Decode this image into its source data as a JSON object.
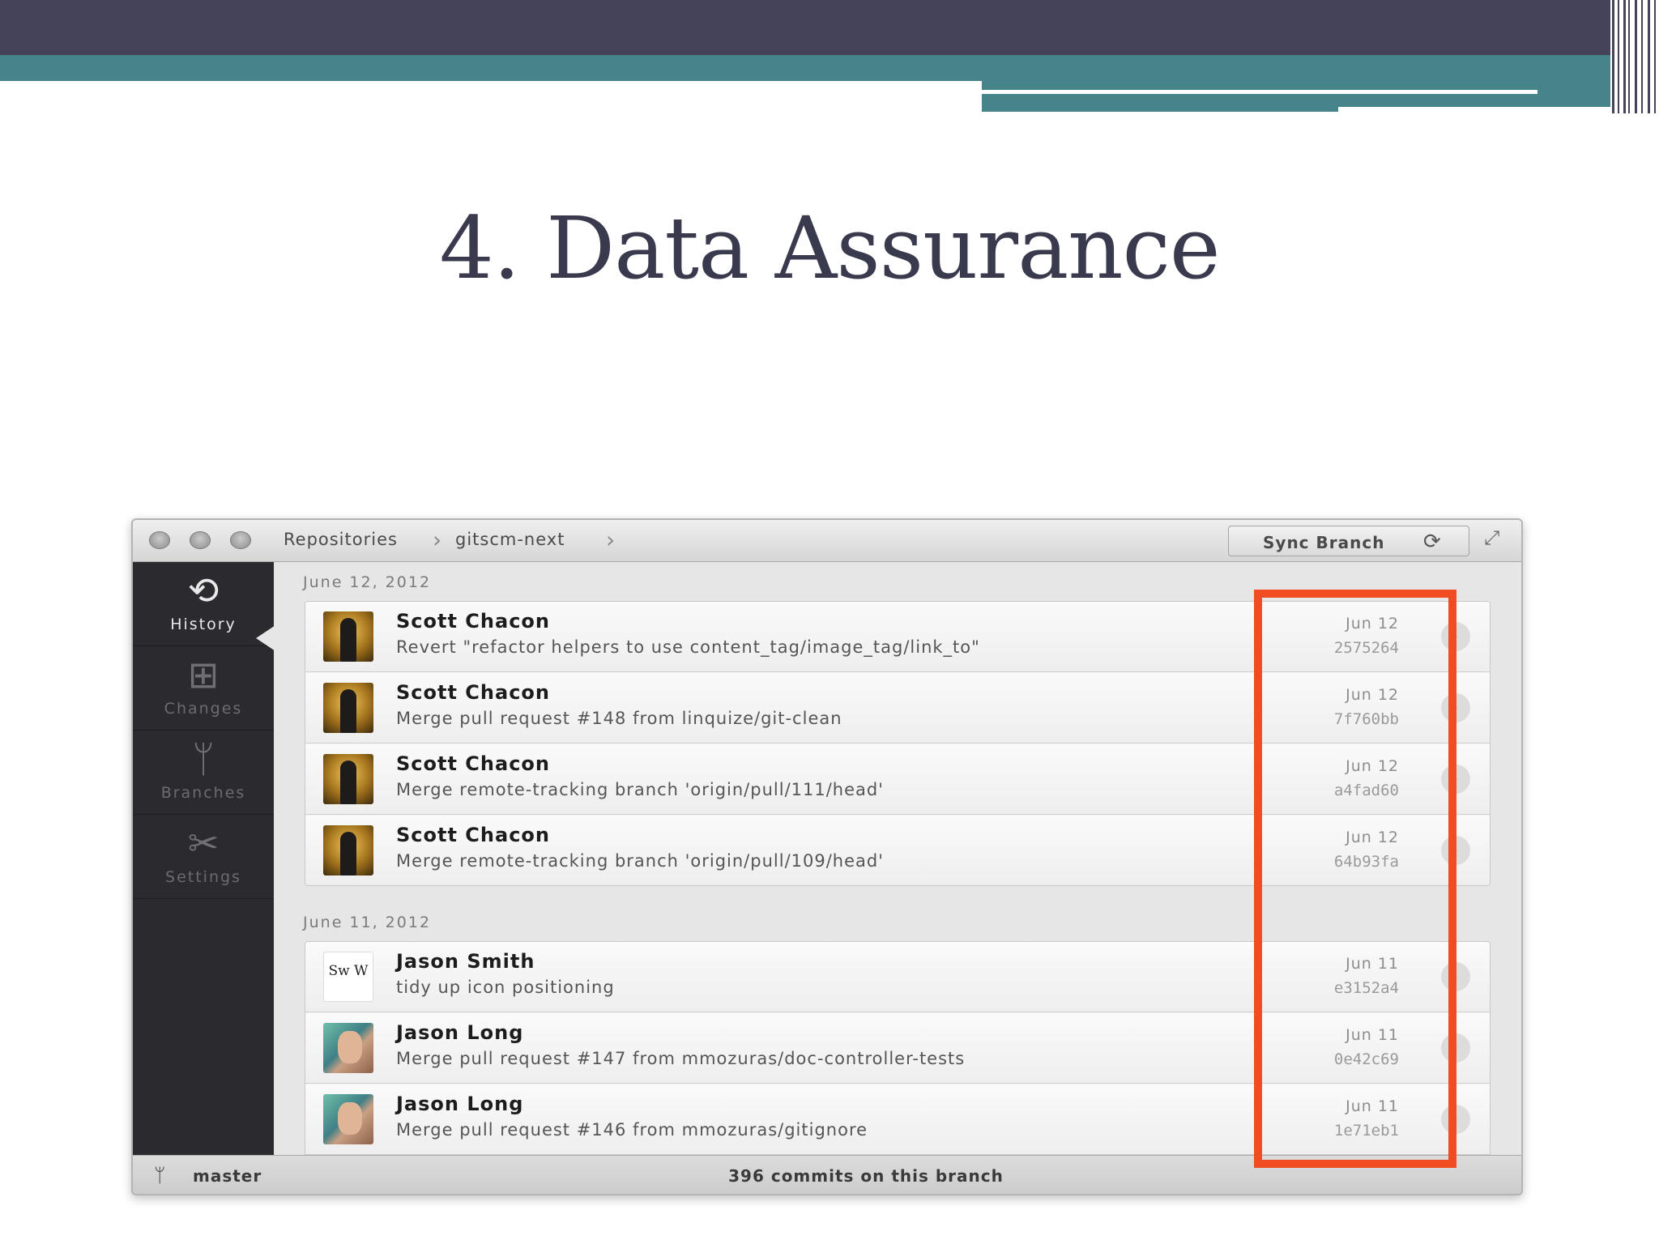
{
  "slide": {
    "title": "4. Data Assurance"
  },
  "window": {
    "breadcrumb": [
      "Repositories",
      "gitscm-next"
    ],
    "sync_button_label": "Sync Branch",
    "sidebar": [
      {
        "label": "History",
        "icon": "history-icon",
        "active": true
      },
      {
        "label": "Changes",
        "icon": "changes-icon",
        "active": false
      },
      {
        "label": "Branches",
        "icon": "branches-icon",
        "active": false
      },
      {
        "label": "Settings",
        "icon": "settings-icon",
        "active": false
      }
    ],
    "groups": [
      {
        "date": "June 12, 2012",
        "commits": [
          {
            "author": "Scott Chacon",
            "message": "Revert \"refactor helpers to use content_tag/image_tag/link_to\"",
            "date": "Jun 12",
            "sha": "2575264"
          },
          {
            "author": "Scott Chacon",
            "message": "Merge pull request #148 from linquize/git-clean",
            "date": "Jun 12",
            "sha": "7f760bb"
          },
          {
            "author": "Scott Chacon",
            "message": "Merge remote-tracking branch 'origin/pull/111/head'",
            "date": "Jun 12",
            "sha": "a4fad60"
          },
          {
            "author": "Scott Chacon",
            "message": "Merge remote-tracking branch 'origin/pull/109/head'",
            "date": "Jun 12",
            "sha": "64b93fa"
          }
        ]
      },
      {
        "date": "June 11, 2012",
        "commits": [
          {
            "author": "Jason Smith",
            "message": "tidy up icon positioning",
            "date": "Jun 11",
            "sha": "e3152a4",
            "avatar_text": "Sw W"
          },
          {
            "author": "Jason Long",
            "message": "Merge pull request #147 from mmozuras/doc-controller-tests",
            "date": "Jun 11",
            "sha": "0e42c69"
          },
          {
            "author": "Jason Long",
            "message": "Merge pull request #146 from mmozuras/gitignore",
            "date": "Jun 11",
            "sha": "1e71eb1"
          }
        ]
      }
    ],
    "status": {
      "branch": "master",
      "commit_count": "396 commits on this branch"
    }
  },
  "colors": {
    "highlight": "#f04d23",
    "header_dark": "#454359",
    "header_teal": "#45858a"
  }
}
